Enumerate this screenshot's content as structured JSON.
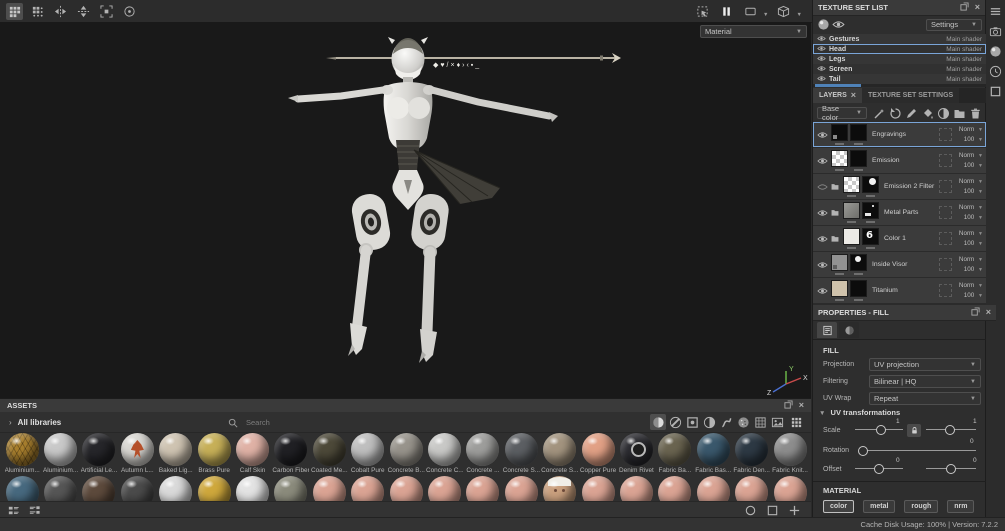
{
  "app": {
    "status_bar": "Cache Disk Usage: 100% | Version: 7.2.2",
    "accent_color": "#7aa5d8"
  },
  "top_toolbar": {
    "left_icons": [
      "grid",
      "grid-dots",
      "symmetry-x",
      "symmetry-y",
      "frame-center",
      "pivot"
    ],
    "right_icons": [
      "marquee",
      "pause",
      "shape-rect",
      "cube",
      "videocam",
      "camera"
    ]
  },
  "right_dock_icons": [
    "menu",
    "camera",
    "sphere",
    "clock",
    "square-panel"
  ],
  "viewport": {
    "shader_mode": "Material",
    "decal_glyphs": "◆♥/×♦›‹▪_",
    "gizmo": {
      "x": "X",
      "y": "Y",
      "z": "Z",
      "x_color": "#c84a4a",
      "y_color": "#6fbf4a",
      "z_color": "#4a6fd0"
    }
  },
  "texture_set_panel": {
    "title": "TEXTURE SET LIST",
    "settings_button": "Settings",
    "toolbar_icons": [
      "sphere",
      "eye"
    ],
    "sets": [
      {
        "name": "Gestures",
        "shader": "Main shader",
        "selected": false
      },
      {
        "name": "Head",
        "shader": "Main shader",
        "selected": true
      },
      {
        "name": "Legs",
        "shader": "Main shader",
        "selected": false
      },
      {
        "name": "Screen",
        "shader": "Main shader",
        "selected": false
      },
      {
        "name": "Tail",
        "shader": "Main shader",
        "selected": false
      }
    ]
  },
  "layers_panel": {
    "tab_layers": "LAYERS",
    "tab_texture_set_settings": "TEXTURE SET SETTINGS",
    "channel_filter": "Base color",
    "toolbar_icons": [
      "wand",
      "refresh",
      "pencil",
      "bucket",
      "sphere-half",
      "folder",
      "trash"
    ],
    "blend_default": "Norm",
    "layers": [
      {
        "name": "Engravings",
        "blend": "Norm",
        "opacity": "100",
        "selected": true,
        "folder": false,
        "eye": "open",
        "thumb1": "black-uv",
        "thumb2": "black"
      },
      {
        "name": "Emission",
        "blend": "Norm",
        "opacity": "100",
        "selected": false,
        "folder": false,
        "eye": "open",
        "thumb1": "checker",
        "thumb2": "black"
      },
      {
        "name": "Emission 2 Filter",
        "blend": "Norm",
        "opacity": "100",
        "selected": false,
        "folder": true,
        "eye": "closed",
        "thumb1": "checker",
        "thumb2": "black-blob"
      },
      {
        "name": "Metal Parts",
        "blend": "Norm",
        "opacity": "100",
        "selected": false,
        "folder": true,
        "eye": "open",
        "thumb1": "gray-texture",
        "thumb2": "black-marks"
      },
      {
        "name": "Color 1",
        "blend": "Norm",
        "opacity": "100",
        "selected": false,
        "folder": true,
        "eye": "open",
        "thumb1": "white",
        "thumb2": "black-glyph"
      },
      {
        "name": "Inside Visor",
        "blend": "Norm",
        "opacity": "100",
        "selected": false,
        "folder": false,
        "eye": "open",
        "thumb1": "gray-uv",
        "thumb2": "black-dot"
      },
      {
        "name": "Titanium",
        "blend": "Norm",
        "opacity": "100",
        "selected": false,
        "folder": false,
        "eye": "open",
        "thumb1": "tan",
        "thumb2": "black"
      }
    ]
  },
  "properties_panel": {
    "title": "PROPERTIES - FILL",
    "section_fill": "FILL",
    "fields": [
      {
        "label": "Projection",
        "value": "UV projection"
      },
      {
        "label": "Filtering",
        "value": "Bilinear | HQ"
      },
      {
        "label": "UV Wrap",
        "value": "Repeat"
      }
    ],
    "uv_transformations": {
      "title": "UV transformations",
      "scale_label": "Scale",
      "scale_x": "1",
      "scale_y": "1",
      "rotation_label": "Rotation",
      "rotation": "0",
      "offset_label": "Offset",
      "offset_x": "0",
      "offset_y": "0"
    },
    "material_section": {
      "title": "MATERIAL",
      "channels": [
        {
          "label": "color",
          "selected": true
        },
        {
          "label": "metal",
          "selected": false
        },
        {
          "label": "rough",
          "selected": false
        },
        {
          "label": "nrm",
          "selected": false
        }
      ]
    }
  },
  "assets_panel": {
    "title": "ASSETS",
    "library_label": "All libraries",
    "search_placeholder": "Search",
    "filter_icons": [
      "ball",
      "ball-slash",
      "square-dot",
      "ball-half",
      "stroke",
      "ball-noise",
      "pattern",
      "image"
    ],
    "row1": [
      {
        "name": "Aluminium...",
        "color": "#a87f2e",
        "style": "honeycomb"
      },
      {
        "name": "Aluminium...",
        "color": "#c9c9c9"
      },
      {
        "name": "Artificial Le...",
        "color": "#26262a"
      },
      {
        "name": "Autumn L...",
        "color": "#d9d7d2",
        "style": "leaf"
      },
      {
        "name": "Baked Lig...",
        "color": "#cfc4b2"
      },
      {
        "name": "Brass Pure",
        "color": "#c7b058"
      },
      {
        "name": "Calf Skin",
        "color": "#e0b2a6"
      },
      {
        "name": "Carbon Fiber",
        "color": "#202024"
      },
      {
        "name": "Coated Me...",
        "color": "#4d4939"
      },
      {
        "name": "Cobalt Pure",
        "color": "#bfbfbf"
      },
      {
        "name": "Concrete B...",
        "color": "#98948c"
      },
      {
        "name": "Concrete C...",
        "color": "#c9c9c7"
      },
      {
        "name": "Concrete ...",
        "color": "#9e9e9c"
      },
      {
        "name": "Concrete S...",
        "color": "#5c5f63"
      },
      {
        "name": "Concrete S...",
        "color": "#a3947f"
      },
      {
        "name": "Copper Pure",
        "color": "#e2a186"
      },
      {
        "name": "Denim Rivet",
        "color": "#2b2b30",
        "style": "rivet"
      },
      {
        "name": "Fabric Ba...",
        "color": "#6a6450"
      },
      {
        "name": "Fabric Bas...",
        "color": "#3a586c"
      },
      {
        "name": "Fabric Den...",
        "color": "#2d3944"
      },
      {
        "name": "Fabric Knit...",
        "color": "#8e8e8e"
      }
    ],
    "row2_colors": [
      "#47697f",
      "#565656",
      "#5d4a3c",
      "#4b4b4b",
      "#dadada",
      "#cfa83c",
      "#e3e3e3",
      "#8b8b7c",
      "#dba494",
      "#dba494",
      "#dba494",
      "#dba494",
      "#dba494",
      "#dba494",
      "#caa07e",
      "#dba494",
      "#dba494",
      "#dba494",
      "#dba494",
      "#dba494",
      "#dba494"
    ],
    "face_sphere_index": 14
  }
}
